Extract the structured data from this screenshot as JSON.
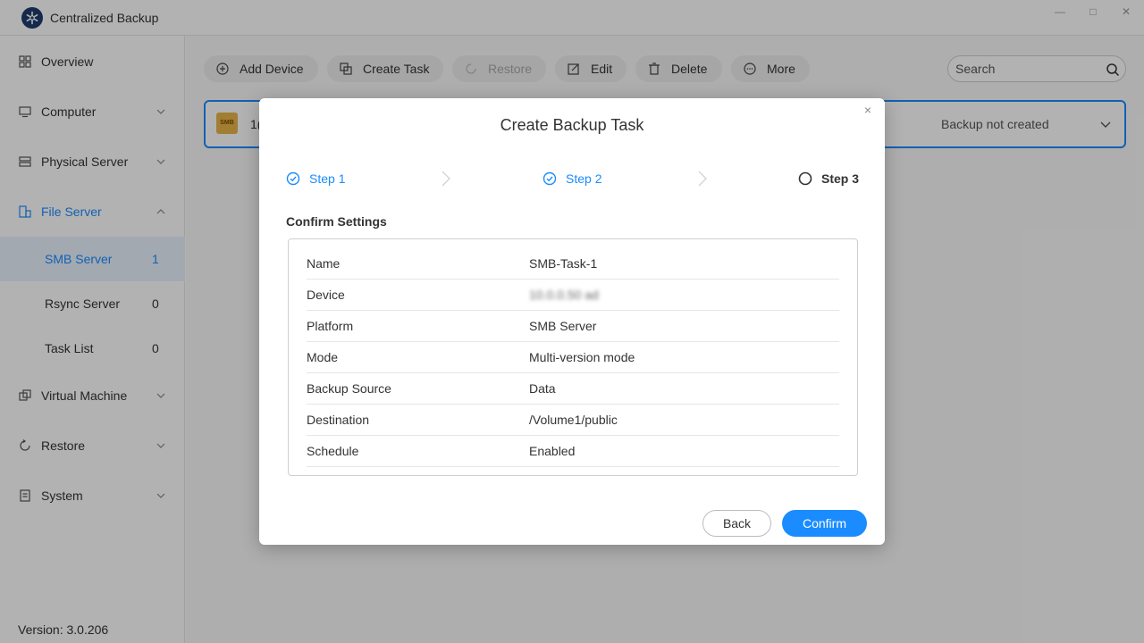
{
  "app": {
    "title": "Centralized Backup",
    "logo_icon": "snowflake-logo-icon"
  },
  "window_controls": {
    "minimize": "—",
    "maximize": "□",
    "close": "✕"
  },
  "sidebar": {
    "items": [
      {
        "label": "Overview",
        "icon": "grid-icon"
      },
      {
        "label": "Computer",
        "icon": "monitor-icon"
      },
      {
        "label": "Physical Server",
        "icon": "server-icon"
      },
      {
        "label": "File Server",
        "icon": "file-server-icon"
      },
      {
        "label": "Virtual Machine",
        "icon": "vm-icon"
      },
      {
        "label": "Restore",
        "icon": "restore-icon"
      },
      {
        "label": "System",
        "icon": "document-icon"
      }
    ],
    "file_server_sub": [
      {
        "label": "SMB Server",
        "count": "1"
      },
      {
        "label": "Rsync Server",
        "count": "0"
      },
      {
        "label": "Task List",
        "count": "0"
      }
    ],
    "version": "Version: 3.0.206"
  },
  "toolbar": {
    "add_device": "Add Device",
    "create_task": "Create Task",
    "restore": "Restore",
    "edit": "Edit",
    "delete": "Delete",
    "more": "More"
  },
  "search": {
    "placeholder": "Search"
  },
  "device": {
    "icon_text": "SMB",
    "name": "1(",
    "status": "Backup not created"
  },
  "modal": {
    "title": "Create Backup Task",
    "close": "×",
    "steps": [
      {
        "label": "Step 1",
        "state": "done"
      },
      {
        "label": "Step 2",
        "state": "done"
      },
      {
        "label": "Step 3",
        "state": "current"
      }
    ],
    "section_title": "Confirm Settings",
    "settings": [
      {
        "key": "Name",
        "value": "SMB-Task-1"
      },
      {
        "key": "Device",
        "value": "10.0.0.50 ad",
        "blurred": true
      },
      {
        "key": "Platform",
        "value": "SMB Server"
      },
      {
        "key": "Mode",
        "value": "Multi-version mode"
      },
      {
        "key": "Backup Source",
        "value": "Data"
      },
      {
        "key": "Destination",
        "value": "/Volume1/public"
      },
      {
        "key": "Schedule",
        "value": "Enabled"
      }
    ],
    "back_label": "Back",
    "confirm_label": "Confirm"
  },
  "colors": {
    "accent": "#1a8cff",
    "selected_bg": "#e8f2fe",
    "overlay": "rgba(0,0,0,0.30)"
  }
}
